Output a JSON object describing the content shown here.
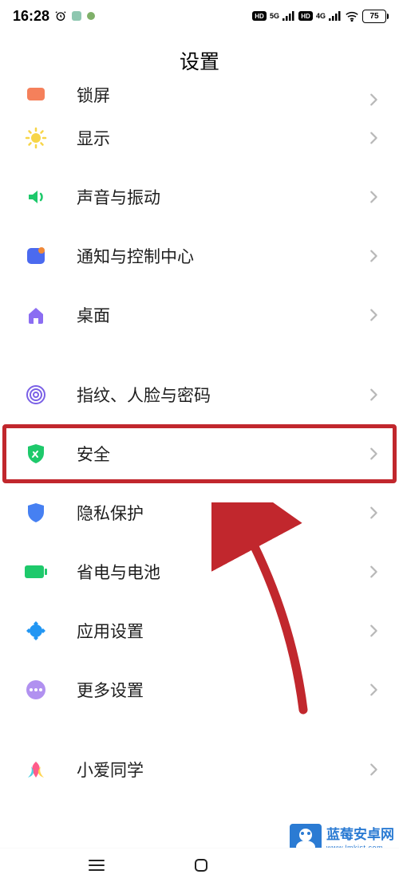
{
  "status": {
    "time": "16:28",
    "battery": "75"
  },
  "title": "设置",
  "rows": {
    "partial": "锁屏",
    "display": "显示",
    "sound": "声音与振动",
    "notification": "通知与控制中心",
    "home": "桌面",
    "biometric": "指纹、人脸与密码",
    "security": "安全",
    "privacy": "隐私保护",
    "battery": "省电与电池",
    "apps": "应用设置",
    "more": "更多设置",
    "xiaoai": "小爱同学"
  },
  "watermark": {
    "title": "蓝莓安卓网",
    "url": "www.lmkjst.com"
  },
  "colors": {
    "highlight": "#c1272d",
    "chevron": "#b8b8b8"
  }
}
